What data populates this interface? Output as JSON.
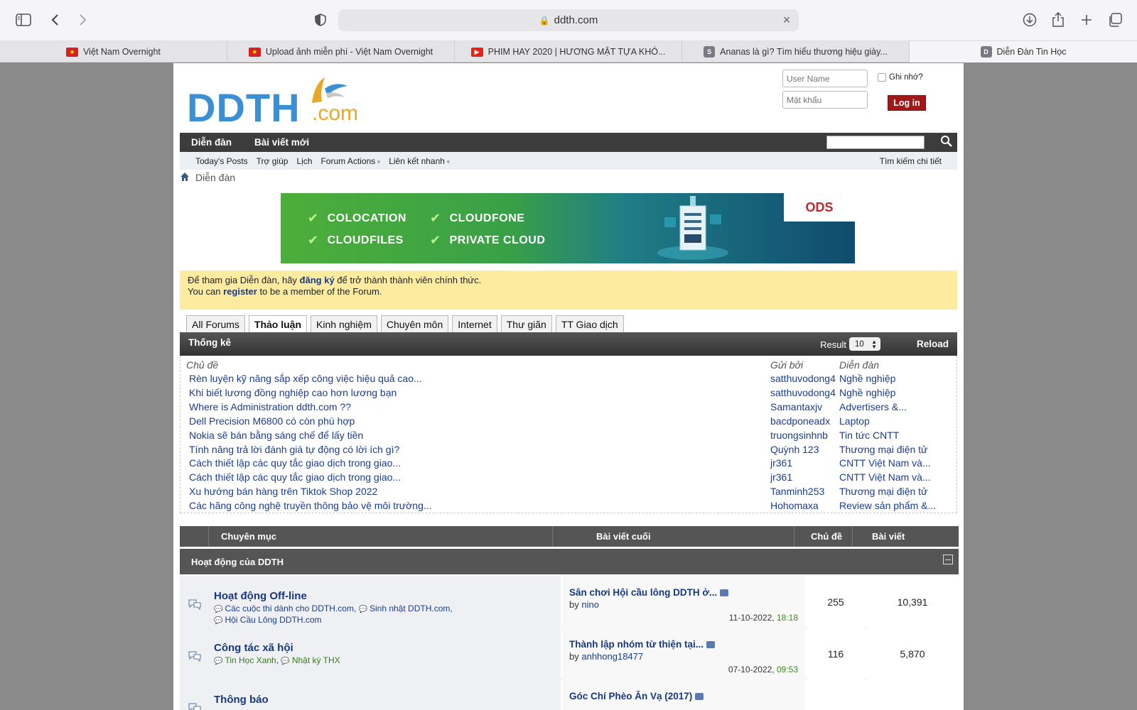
{
  "browser": {
    "url": "ddth.com",
    "tabs": [
      {
        "label": "Việt Nam Overnight",
        "icon": "vietnam-flag-icon"
      },
      {
        "label": "Upload ảnh miễn phí - Việt Nam Overnight",
        "icon": "vietnam-flag-icon"
      },
      {
        "label": "PHIM HAY 2020 | HƯƠNG MẬT TỰA KHÓ...",
        "icon": "youtube-icon"
      },
      {
        "label": "Ananas là gì? Tìm hiểu thương hiệu giày...",
        "icon": "s-letter-icon"
      },
      {
        "label": "Diễn Đàn Tin Học",
        "icon": "d-letter-icon"
      }
    ],
    "fav_letters": {
      "s": "S",
      "d": "D"
    }
  },
  "header": {
    "logo_main": "DDTH",
    "logo_suffix": ".com",
    "username_placeholder": "User Name",
    "password_placeholder": "Mật khẩu",
    "remember_label": "Ghi nhớ?",
    "login_label": "Log in"
  },
  "nav": {
    "items": [
      "Diễn đàn",
      "Bài viết mới"
    ],
    "sub_items": [
      "Today's Posts",
      "Trợ giúp",
      "Lịch",
      "Forum Actions",
      "Liên kết nhanh"
    ],
    "advanced_search": "Tìm kiếm chi tiết"
  },
  "breadcrumb": {
    "label": "Diễn đàn"
  },
  "banner": {
    "items": [
      "COLOCATION",
      "CLOUDFONE",
      "CLOUDFILES",
      "PRIVATE CLOUD"
    ],
    "brand": "ODS"
  },
  "notice": {
    "line1_pre": "Để tham gia Diễn đàn, hãy ",
    "line1_link": "đăng ký",
    "line1_post": " để trở thành thành viên chính thức.",
    "line2_pre": "You can ",
    "line2_link": "register",
    "line2_post": " to be a member of the Forum."
  },
  "forum_tabs": [
    "All Forums",
    "Thảo luận",
    "Kinh nghiệm",
    "Chuyên môn",
    "Internet",
    "Thư giãn",
    "TT Giao dịch"
  ],
  "stats": {
    "title": "Thống kê",
    "result_label": "Result",
    "result_value": "10",
    "reload_label": "Reload",
    "col_topic": "Chủ đề",
    "col_by": "Gửi bởi",
    "col_forum": "Diễn đàn",
    "rows": [
      {
        "topic": "Rèn luyện kỹ năng sắp xếp công việc hiệu quả cao...",
        "by": "satthuvodong4",
        "forum": "Nghề nghiệp"
      },
      {
        "topic": "Khi biết lương đồng nghiệp cao hơn lương bạn",
        "by": "satthuvodong4",
        "forum": "Nghề nghiệp"
      },
      {
        "topic": "Where is Administration ddth.com ??",
        "by": "Samantaxjv",
        "forum": "Advertisers &..."
      },
      {
        "topic": "Dell Precision M6800 có còn phù hợp",
        "by": "bacdponeadx",
        "forum": "Laptop"
      },
      {
        "topic": "Nokia sẽ bán bằng sáng chế để lấy tiền",
        "by": "truongsinhnb",
        "forum": "Tin tức CNTT"
      },
      {
        "topic": "Tính năng trả lời đánh giá tự động có lời ích gì?",
        "by": "Quỳnh 123",
        "forum": "Thương mại điện tử"
      },
      {
        "topic": "Cách thiết lập các quy tắc giao dịch trong giao...",
        "by": "jr361",
        "forum": "CNTT Việt Nam và..."
      },
      {
        "topic": "Cách thiết lập các quy tắc giao dịch trong giao...",
        "by": "jr361",
        "forum": "CNTT Việt Nam và..."
      },
      {
        "topic": "Xu hướng bán hàng trên Tiktok Shop 2022",
        "by": "Tanminh253",
        "forum": "Thương mại điện tử"
      },
      {
        "topic": "Các hãng công nghệ truyền thông bảo vệ môi trường...",
        "by": "Hohomaxa",
        "forum": "Review sản phẩm &..."
      }
    ]
  },
  "category_header": {
    "col_category": "Chuyên mục",
    "col_last_post": "Bài viết cuối",
    "col_threads": "Chủ đề",
    "col_posts": "Bài viết"
  },
  "section": {
    "title": "Hoạt động của DDTH"
  },
  "forums": [
    {
      "title": "Hoạt động Off-line",
      "subforums": [
        "Các cuộc thi dành cho DDTH.com",
        "Sinh nhật DDTH.com",
        "Hội Cầu Lông DDTH.com"
      ],
      "last_title": "Sân chơi Hội cầu lông DDTH ở...",
      "by_label": "by",
      "last_by": "nino",
      "last_date": "11-10-2022,",
      "last_time": "18:18",
      "threads": "255",
      "posts": "10,391"
    },
    {
      "title": "Công tác xã hội",
      "subforums": [
        "Tin Học Xanh",
        "Nhật ký THX"
      ],
      "last_title": "Thành lập nhóm từ thiện tại...",
      "by_label": "by",
      "last_by": "anhhong18477",
      "last_date": "07-10-2022,",
      "last_time": "09:53",
      "threads": "116",
      "posts": "5,870"
    },
    {
      "title": "Thông báo",
      "subforums": [],
      "last_title": "Góc Chí Phèo Ăn Vạ (2017)",
      "by_label": "",
      "last_by": "",
      "last_date": "",
      "last_time": "",
      "threads": "",
      "posts": ""
    }
  ]
}
